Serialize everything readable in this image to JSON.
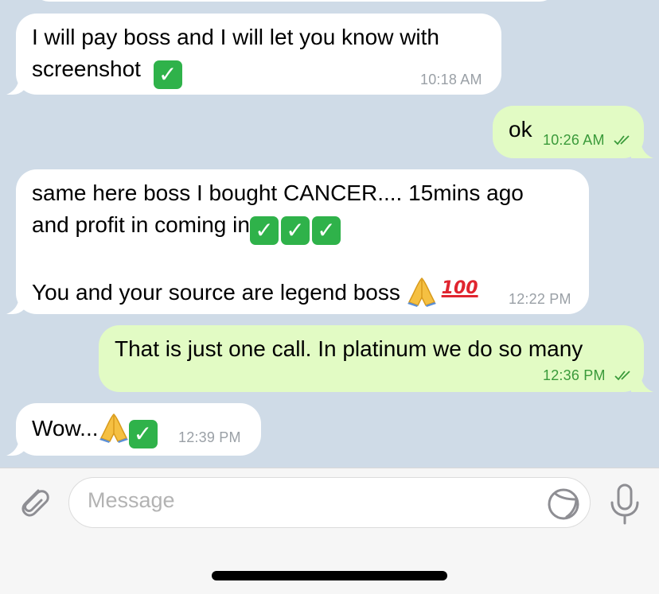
{
  "messages": [
    {
      "id": "m1",
      "direction": "incoming",
      "line1": "I will pay boss and I will let you know with",
      "line2": "screenshot",
      "emoji": "check-mark-button",
      "time": "10:18 AM"
    },
    {
      "id": "m2",
      "direction": "outgoing",
      "text": "ok",
      "time": "10:26 AM",
      "status": "read"
    },
    {
      "id": "m3",
      "direction": "incoming",
      "line1": "same here boss I bought CANCER.... 15mins ago",
      "line2": "and profit in coming in",
      "line3": "You and your source are legend boss",
      "emoji_100": "100",
      "time": "12:22 PM"
    },
    {
      "id": "m4",
      "direction": "outgoing",
      "text": "That is just one call. In platinum we do so many",
      "time": "12:36 PM",
      "status": "read"
    },
    {
      "id": "m5",
      "direction": "incoming",
      "text": "Wow...",
      "time": "12:39 PM"
    }
  ],
  "composer": {
    "placeholder": "Message",
    "attach_icon": "paperclip-icon",
    "sticker_icon": "sticker-icon",
    "mic_icon": "microphone-icon"
  },
  "colors": {
    "chat_background": "#cfdbe7",
    "incoming_bubble": "#ffffff",
    "outgoing_bubble": "#e2fbc4",
    "outgoing_time": "#3a9a3a",
    "incoming_time": "#9aa0a6"
  }
}
